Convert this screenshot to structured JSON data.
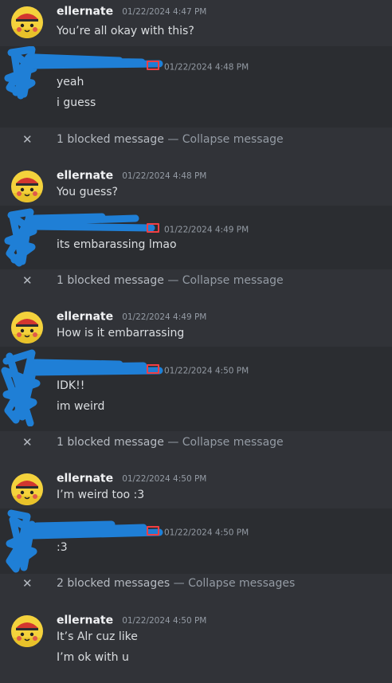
{
  "colors": {
    "background": "#313338",
    "highlight": "#2b2d31",
    "scribble": "#1f7fd6",
    "mod_icon": "#f23f43"
  },
  "messages": [
    {
      "author": "ellernate",
      "timestamp": "01/22/2024 4:47 PM",
      "lines": [
        "You’re all okay with this?"
      ]
    },
    {
      "author": "",
      "timestamp": "01/22/2024 4:48 PM",
      "lines": [
        "yeah",
        "i guess"
      ]
    },
    {
      "author": "ellernate",
      "timestamp": "01/22/2024 4:48 PM",
      "lines": [
        "You guess?"
      ]
    },
    {
      "author": "",
      "timestamp": "01/22/2024 4:49 PM",
      "lines": [
        "its embarassing lmao"
      ]
    },
    {
      "author": "ellernate",
      "timestamp": "01/22/2024 4:49 PM",
      "lines": [
        "How is it embarrassing"
      ]
    },
    {
      "author": "",
      "timestamp": "01/22/2024 4:50 PM",
      "lines": [
        "IDK!!",
        "im weird"
      ]
    },
    {
      "author": "ellernate",
      "timestamp": "01/22/2024 4:50 PM",
      "lines": [
        "I’m weird too :3"
      ]
    },
    {
      "author": "",
      "timestamp": "01/22/2024 4:50 PM",
      "lines": [
        ":3"
      ]
    },
    {
      "author": "ellernate",
      "timestamp": "01/22/2024 4:50 PM",
      "lines": [
        "It’s Alr cuz like",
        "I’m ok with u"
      ]
    }
  ],
  "blocked": [
    {
      "count_text": "1 blocked message",
      "separator": "—",
      "action": "Collapse message"
    },
    {
      "count_text": "1 blocked message",
      "separator": "—",
      "action": "Collapse message"
    },
    {
      "count_text": "1 blocked message",
      "separator": "—",
      "action": "Collapse message"
    },
    {
      "count_text": "2 blocked messages",
      "separator": "—",
      "action": "Collapse messages"
    }
  ],
  "icons": {
    "avatar": "pikachu-cap-avatar",
    "close": "close-icon",
    "mod": "monitor-icon"
  }
}
